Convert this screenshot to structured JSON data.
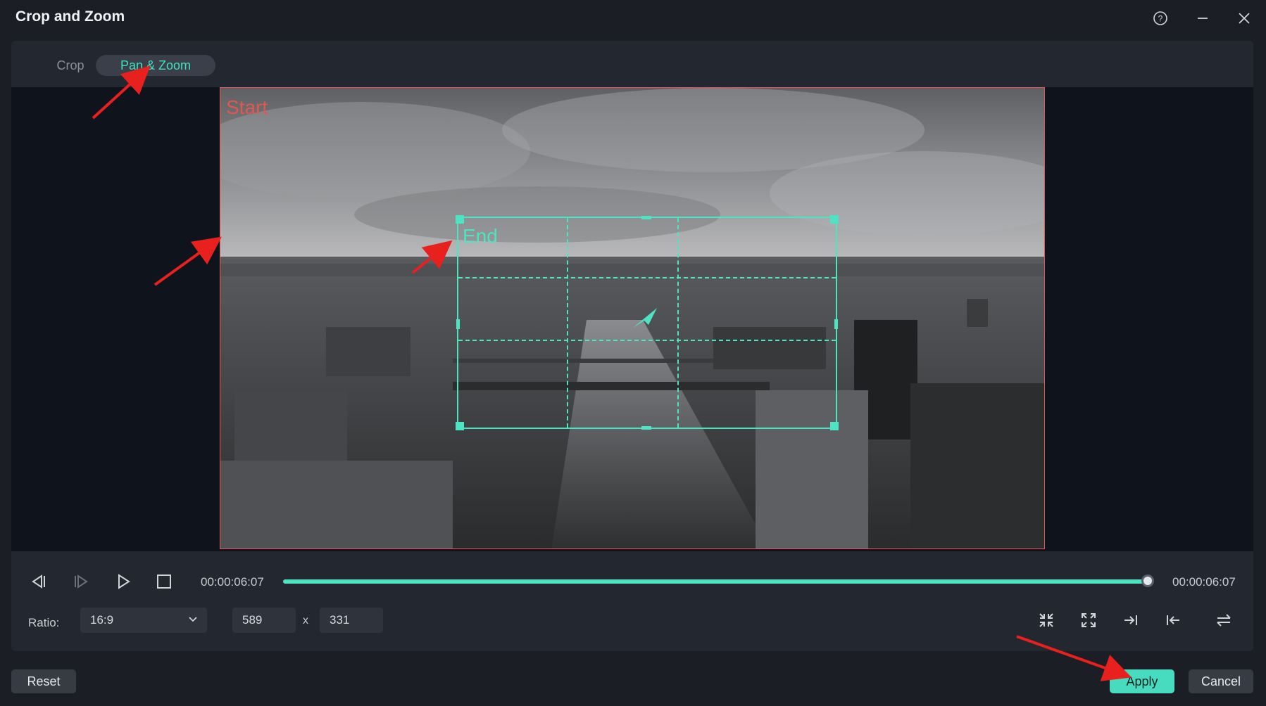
{
  "window": {
    "title": "Crop and Zoom"
  },
  "tabs": [
    {
      "label": "Crop",
      "active": false
    },
    {
      "label": "Pan & Zoom",
      "active": true
    }
  ],
  "preview": {
    "start_label": "Start",
    "end_label": "End"
  },
  "playback": {
    "current_time": "00:00:06:07",
    "total_time": "00:00:06:07",
    "progress": 1.0
  },
  "ratio": {
    "label": "Ratio:",
    "selected": "16:9",
    "width": "589",
    "separator": "x",
    "height": "331"
  },
  "footer": {
    "reset_label": "Reset",
    "apply_label": "Apply",
    "cancel_label": "Cancel"
  },
  "colors": {
    "accent": "#47dcbf",
    "start_box": "#e0584f",
    "annotation_arrow": "#e8201e"
  }
}
